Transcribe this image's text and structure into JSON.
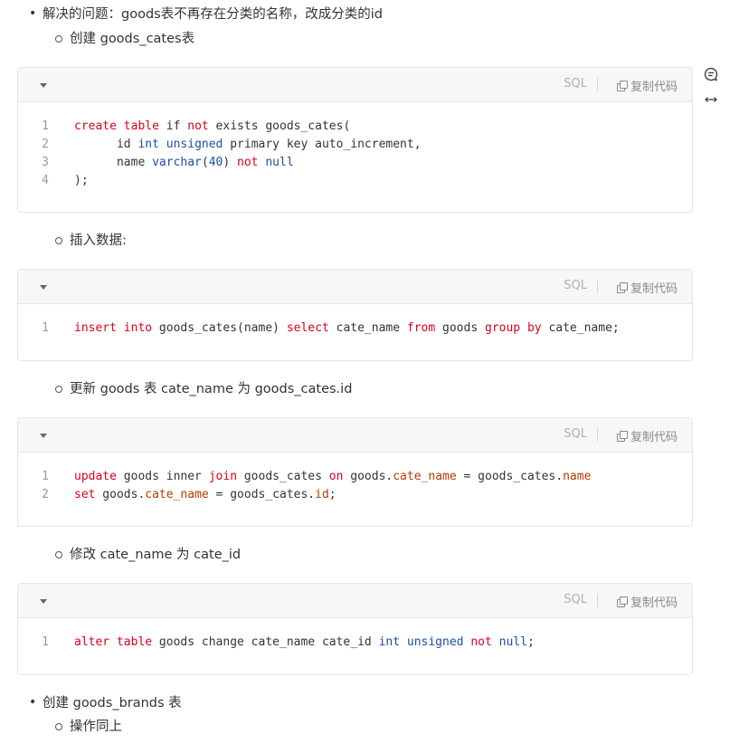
{
  "items": {
    "b1": "解决的问题：goods表不再存在分类的名称，改成分类的id",
    "s1": "创建 goods_cates表",
    "s2": "插入数据:",
    "s3": "更新 goods 表 cate_name 为 goods_cates.id",
    "s4": "修改 cate_name 为 cate_id",
    "b2": "创建 goods_brands 表",
    "s5": "操作同上"
  },
  "code_header": {
    "language": "SQL",
    "copy_label": "复制代码"
  },
  "blocks": [
    {
      "lines": [
        [
          [
            "create",
            "kw"
          ],
          [
            " "
          ],
          [
            "table",
            "kw"
          ],
          [
            " if "
          ],
          [
            "not",
            "kw"
          ],
          [
            " exists goods_cates("
          ]
        ],
        [
          [
            "      id "
          ],
          [
            "int",
            "ty"
          ],
          [
            " "
          ],
          [
            "unsigned",
            "ty"
          ],
          [
            " primary key auto_increment,"
          ]
        ],
        [
          [
            "      name "
          ],
          [
            "varchar",
            "ty"
          ],
          [
            "("
          ],
          [
            "40",
            "nu"
          ],
          [
            ") "
          ],
          [
            "not",
            "kw"
          ],
          [
            " "
          ],
          [
            "null",
            "ty"
          ]
        ],
        [
          [
            ");"
          ]
        ]
      ]
    },
    {
      "lines": [
        [
          [
            "insert",
            "kw"
          ],
          [
            " "
          ],
          [
            "into",
            "kw"
          ],
          [
            " goods_cates(name) "
          ],
          [
            "select",
            "kw"
          ],
          [
            " cate_name "
          ],
          [
            "from",
            "kw"
          ],
          [
            " goods "
          ],
          [
            "group",
            "kw"
          ],
          [
            " "
          ],
          [
            "by",
            "kw"
          ],
          [
            " cate_name;"
          ]
        ]
      ]
    },
    {
      "lines": [
        [
          [
            "update",
            "kw"
          ],
          [
            " goods inner "
          ],
          [
            "join",
            "kw"
          ],
          [
            " goods_cates "
          ],
          [
            "on",
            "kw"
          ],
          [
            " goods."
          ],
          [
            "cate_name",
            "pr"
          ],
          [
            " = goods_cates."
          ],
          [
            "name",
            "pr"
          ]
        ],
        [
          [
            "set",
            "kw"
          ],
          [
            " goods."
          ],
          [
            "cate_name",
            "pr"
          ],
          [
            " = goods_cates."
          ],
          [
            "id",
            "pr"
          ],
          [
            ";"
          ]
        ]
      ]
    },
    {
      "lines": [
        [
          [
            "alter",
            "kw"
          ],
          [
            " "
          ],
          [
            "table",
            "kw"
          ],
          [
            " goods change cate_name cate_id "
          ],
          [
            "int",
            "ty"
          ],
          [
            " "
          ],
          [
            "unsigned",
            "ty"
          ],
          [
            " "
          ],
          [
            "not",
            "kw"
          ],
          [
            " "
          ],
          [
            "null",
            "ty"
          ],
          [
            ";"
          ]
        ]
      ]
    }
  ],
  "colors": {
    "keyword": "#d8001c",
    "type": "#1b4fa3",
    "property": "#b53a00"
  },
  "side_icons": [
    "comment-icon",
    "expand-width-icon"
  ]
}
